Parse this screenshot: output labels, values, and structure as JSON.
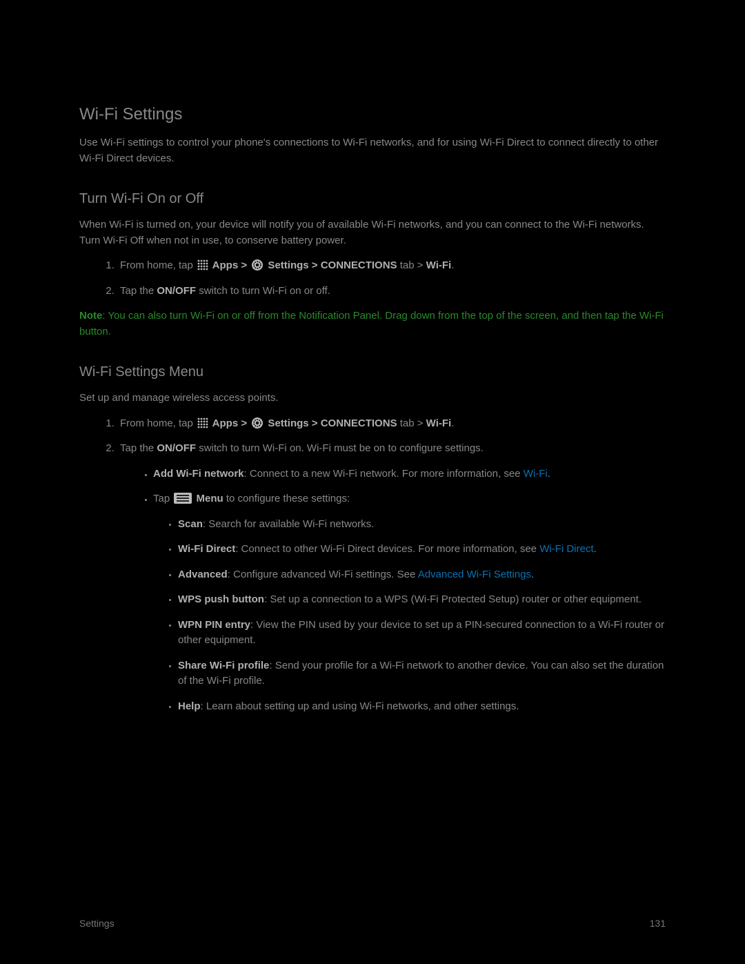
{
  "heading": "Wi-Fi Settings",
  "intro": "Use Wi-Fi settings to control your phone's connections to Wi-Fi networks, and for using Wi-Fi Direct to connect directly to other Wi-Fi Direct devices.",
  "section1": {
    "title": "Turn Wi-Fi On or Off",
    "desc": "When Wi-Fi is turned on, your device will notify you of available Wi-Fi networks, and you can connect to the Wi-Fi networks. Turn Wi-Fi Off when not in use, to conserve battery power.",
    "step1_prefix": "From home, tap ",
    "step1_apps": " Apps > ",
    "step1_settings": " Settings > CONNECTIONS",
    "step1_tab": " tab > ",
    "step1_wifi": "Wi-Fi",
    "step1_end": ".",
    "step2_a": "Tap the ",
    "step2_b": "ON/OFF",
    "step2_c": " switch to turn Wi-Fi on or off."
  },
  "note_label": "Note",
  "note_text": ": You can also turn Wi-Fi on or off from the Notification Panel. Drag down from the top of the screen, and then tap the Wi-Fi button.",
  "section2": {
    "title": "Wi-Fi Settings Menu",
    "desc": "Set up and manage wireless access points.",
    "step1_prefix": "From home, tap ",
    "step1_apps": " Apps > ",
    "step1_settings": " Settings > CONNECTIONS",
    "step1_tab": " tab > ",
    "step1_wifi": "Wi-Fi",
    "step1_end": ".",
    "step2_a": "Tap the ",
    "step2_b": "ON/OFF",
    "step2_c": " switch to turn Wi-Fi on. Wi-Fi must be on to configure settings.",
    "bullet_add_b": "Add Wi-Fi network",
    "bullet_add_t": ": Connect to a new Wi-Fi network. For more information, see ",
    "bullet_add_link": "Wi-Fi",
    "bullet_add_end": ".",
    "bullet_menu_pre": "Tap ",
    "bullet_menu_b": " Menu",
    "bullet_menu_t": " to configure these settings:",
    "menu": {
      "scan_b": "Scan",
      "scan_t": ": Search for available Wi-Fi networks.",
      "wfd_b": "Wi-Fi Direct",
      "wfd_t": ": Connect to other Wi-Fi Direct devices. For more information, see ",
      "wfd_link": "Wi-Fi Direct",
      "wfd_end": ".",
      "adv_b": "Advanced",
      "adv_t": ": Configure advanced Wi-Fi settings. See ",
      "adv_link": "Advanced Wi-Fi Settings",
      "adv_end": ".",
      "wps_b": "WPS push button",
      "wps_t": ": Set up a connection to a WPS (Wi-Fi Protected Setup) router or other equipment.",
      "wpn_b": "WPN PIN entry",
      "wpn_t": ": View the PIN used by your device to set up a PIN-secured connection to a Wi-Fi router or other equipment.",
      "share_b": "Share Wi-Fi profile",
      "share_t": ": Send your profile for a Wi-Fi network to another device. You can also set the duration of the Wi-Fi profile.",
      "help_b": "Help",
      "help_t": ": Learn about setting up and using Wi-Fi networks, and other settings."
    }
  },
  "footer_left": "Settings",
  "footer_right": "131"
}
